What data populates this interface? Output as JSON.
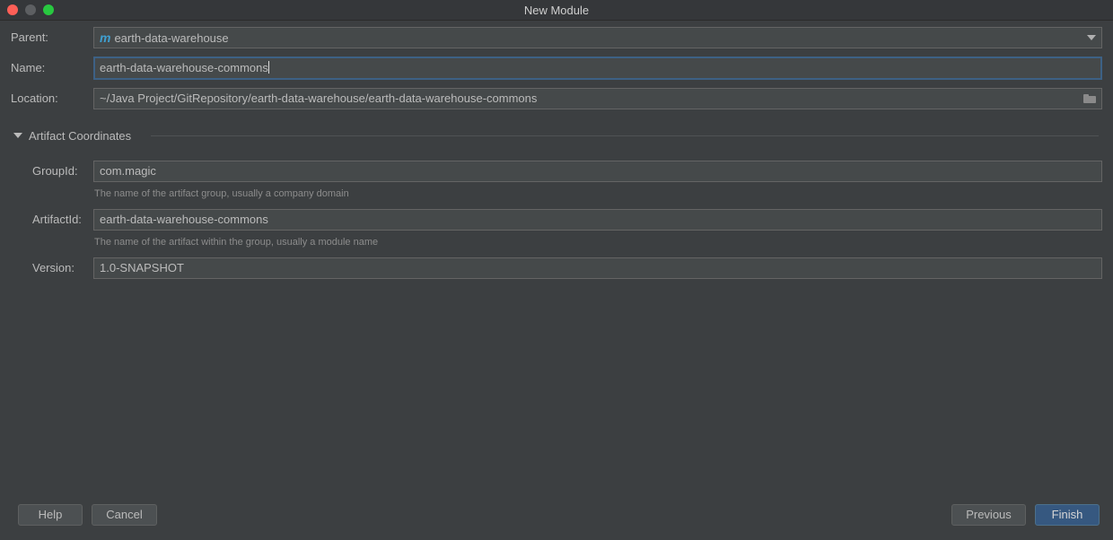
{
  "window": {
    "title": "New Module"
  },
  "form": {
    "parent": {
      "label": "Parent:",
      "icon": "maven-m-icon",
      "icon_text": "m",
      "value": "earth-data-warehouse"
    },
    "name": {
      "label": "Name:",
      "value": "earth-data-warehouse-commons"
    },
    "location": {
      "label": "Location:",
      "value": "~/Java Project/GitRepository/earth-data-warehouse/earth-data-warehouse-commons",
      "icon": "folder-icon"
    }
  },
  "artifact": {
    "section_title": "Artifact Coordinates",
    "groupId": {
      "label": "GroupId:",
      "value": "com.magic",
      "hint": "The name of the artifact group, usually a company domain"
    },
    "artifactId": {
      "label": "ArtifactId:",
      "value": "earth-data-warehouse-commons",
      "hint": "The name of the artifact within the group, usually a module name"
    },
    "version": {
      "label": "Version:",
      "value": "1.0-SNAPSHOT"
    }
  },
  "buttons": {
    "help": "Help",
    "cancel": "Cancel",
    "previous": "Previous",
    "finish": "Finish"
  },
  "colors": {
    "background": "#3c3f41",
    "field": "#45494a",
    "focus_border": "#3d6185",
    "primary_button": "#365880",
    "maven_icon": "#3f9fd0"
  }
}
